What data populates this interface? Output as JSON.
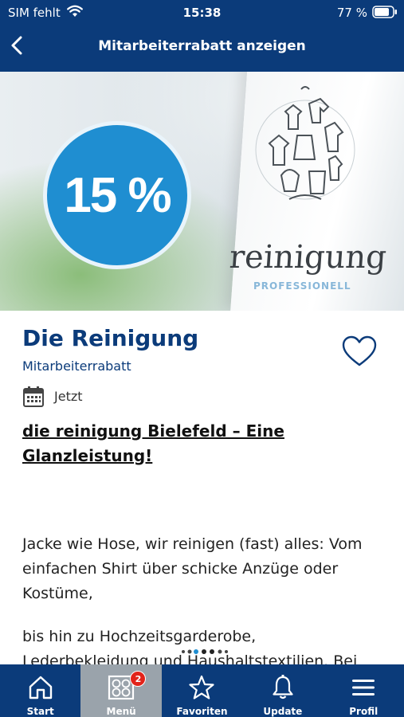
{
  "status_bar": {
    "carrier": "SIM fehlt",
    "time": "15:38",
    "battery": "77 %"
  },
  "nav": {
    "title": "Mitarbeiterrabatt anzeigen"
  },
  "hero": {
    "discount": "15 %",
    "brand": "reinigung",
    "brand_sub": "PROFESSIONELL",
    "accent_color": "#1f8ed1"
  },
  "detail": {
    "title": "Die Reinigung",
    "subtitle": "Mitarbeiterrabatt",
    "date": "Jetzt",
    "headline": "die reinigung Bielefeld – Eine Glanzleistung! ",
    "body_1": "Jacke wie Hose, wir reinigen (fast) alles: Vom einfachen Shirt über schicke Anzüge oder Kostüme,",
    "body_2_line1": "bis hin zu Hochzeitsgarderobe,",
    "body_2_line2": "Lederbekleidung und Haushaltstextilien. Bei"
  },
  "tabbar": {
    "tabs": [
      {
        "label": "Start",
        "icon": "home-icon"
      },
      {
        "label": "Menü",
        "icon": "grid-icon",
        "badge": "2",
        "active": true
      },
      {
        "label": "Favoriten",
        "icon": "star-icon"
      },
      {
        "label": "Update",
        "icon": "bell-icon"
      },
      {
        "label": "Profil",
        "icon": "menu-icon"
      }
    ]
  },
  "colors": {
    "primary": "#0b3b7a",
    "badge": "#e2231a",
    "active_tab": "#9aa3ab"
  }
}
